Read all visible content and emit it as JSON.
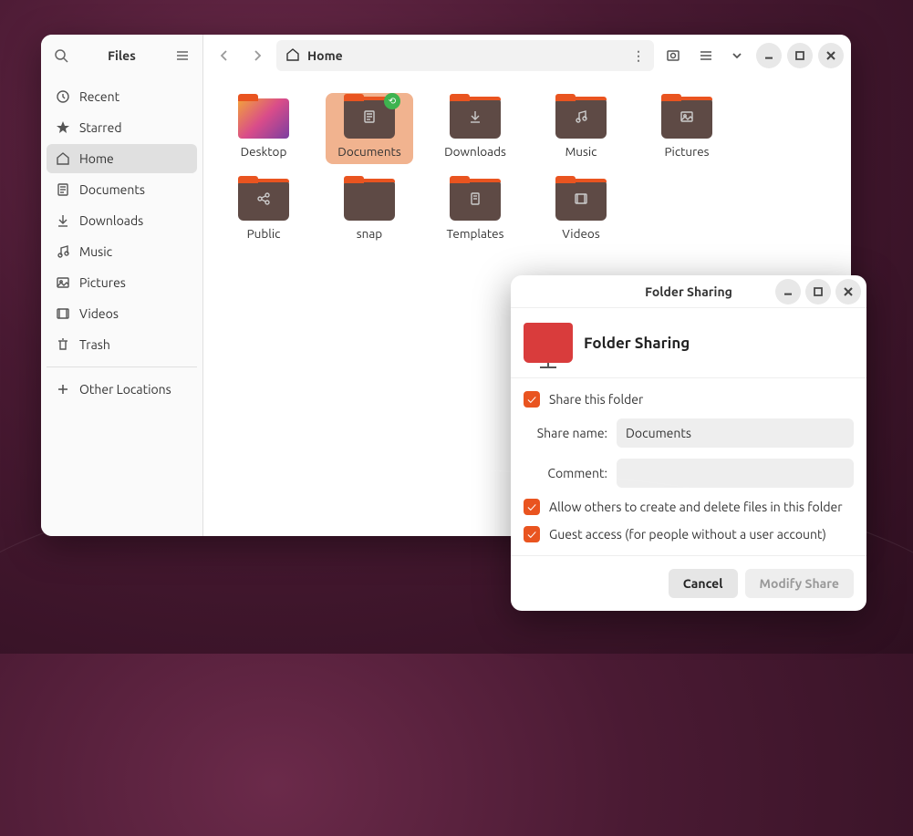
{
  "sidebar": {
    "title": "Files",
    "items": [
      {
        "label": "Recent",
        "icon": "clock"
      },
      {
        "label": "Starred",
        "icon": "star"
      },
      {
        "label": "Home",
        "icon": "home",
        "active": true
      },
      {
        "label": "Documents",
        "icon": "doc"
      },
      {
        "label": "Downloads",
        "icon": "download"
      },
      {
        "label": "Music",
        "icon": "music"
      },
      {
        "label": "Pictures",
        "icon": "picture"
      },
      {
        "label": "Videos",
        "icon": "video"
      },
      {
        "label": "Trash",
        "icon": "trash"
      }
    ],
    "other": {
      "label": "Other Locations",
      "icon": "plus"
    }
  },
  "path": {
    "label": "Home"
  },
  "grid": [
    {
      "label": "Desktop",
      "type": "desktop"
    },
    {
      "label": "Documents",
      "glyph": "doc",
      "selected": true,
      "shared": true
    },
    {
      "label": "Downloads",
      "glyph": "download"
    },
    {
      "label": "Music",
      "glyph": "music"
    },
    {
      "label": "Pictures",
      "glyph": "picture"
    },
    {
      "label": "Public",
      "glyph": "share"
    },
    {
      "label": "snap"
    },
    {
      "label": "Templates",
      "glyph": "template"
    },
    {
      "label": "Videos",
      "glyph": "video"
    }
  ],
  "dialog": {
    "title": "Folder Sharing",
    "heading": "Folder Sharing",
    "share_this": "Share this folder",
    "share_name_label": "Share name:",
    "share_name_value": "Documents",
    "comment_label": "Comment:",
    "comment_value": "",
    "allow_others": "Allow others to create and delete files in this folder",
    "guest_access": "Guest access (for people without a user account)",
    "cancel": "Cancel",
    "modify": "Modify Share"
  }
}
